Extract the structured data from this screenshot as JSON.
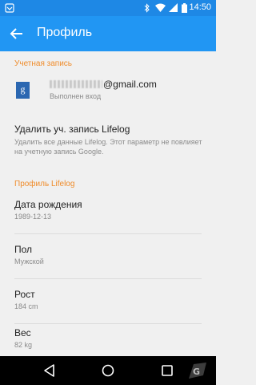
{
  "status_bar": {
    "time": "14:50",
    "icons": [
      "notification-icon",
      "bluetooth-icon",
      "wifi-icon",
      "signal-icon",
      "battery-icon"
    ]
  },
  "app_bar": {
    "title": "Профиль",
    "back_icon": "arrow-back-icon",
    "color": "#2196f3"
  },
  "account_section": {
    "header": "Учетная запись",
    "provider_icon": "google-icon",
    "provider_letter": "g",
    "email_visible": "@gmail.com",
    "status": "Выполнен вход"
  },
  "delete_account": {
    "title": "Удалить уч. запись Lifelog",
    "description": "Удалить все данные Lifelog. Этот параметр не повлияет на учетную запись Google."
  },
  "profile_section": {
    "header": "Профиль Lifelog",
    "items": [
      {
        "label": "Дата рождения",
        "value": "1989-12-13"
      },
      {
        "label": "Пол",
        "value": "Мужской"
      },
      {
        "label": "Рост",
        "value": "184 cm"
      },
      {
        "label": "Вес",
        "value": "82 kg"
      }
    ]
  },
  "nav_bar": {
    "buttons": [
      "back-nav-icon",
      "home-nav-icon",
      "recents-nav-icon"
    ]
  },
  "colors": {
    "accent": "#ef8c2b",
    "status_bar": "#1e88e5",
    "background": "#f0f0f0"
  }
}
